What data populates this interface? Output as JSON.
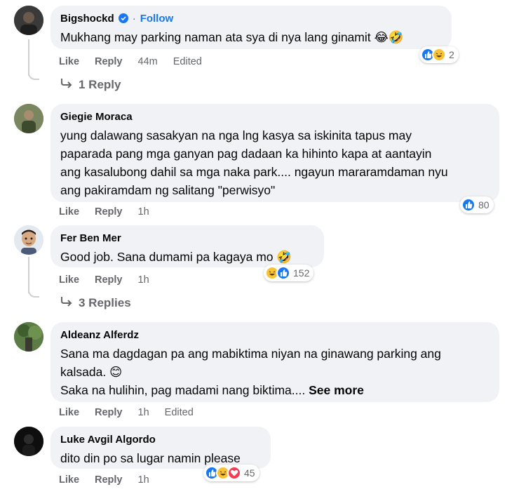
{
  "comments": [
    {
      "name": "Bigshockd",
      "verified": true,
      "follow": "Follow",
      "dot": "·",
      "text": "Mukhang may parking naman ata sya di nya lang ginamit 😂🤣",
      "like": "Like",
      "reply": "Reply",
      "time": "44m",
      "edited": "Edited",
      "reactions": [
        "like",
        "haha"
      ],
      "reaction_count": "2",
      "replies_label": "1 Reply"
    },
    {
      "name": "Giegie Moraca",
      "text_lines": [
        "yung dalawang sasakyan na nga lng kasya sa iskinita tapus may",
        "paparada pang mga ganyan pag dadaan ka hihinto kapa at aantayin",
        "ang kasalubong dahil sa mga naka park.... ngayun mararamdaman nyu",
        "ang pakiramdam ng salitang \"perwisyo\""
      ],
      "like": "Like",
      "reply": "Reply",
      "time": "1h",
      "reactions": [
        "like"
      ],
      "reaction_count": "80"
    },
    {
      "name": "Fer Ben Mer",
      "text": "Good job. Sana dumami pa kagaya mo 🤣",
      "like": "Like",
      "reply": "Reply",
      "time": "1h",
      "reactions": [
        "haha",
        "like"
      ],
      "reaction_count": "152",
      "replies_label": "3 Replies"
    },
    {
      "name": "Aldeanz Alferdz",
      "text_line1": "Sana ma dagdagan pa ang mabiktima niyan na ginawang parking ang",
      "text_line2": "kalsada. 😊",
      "text_line3": "Saka na hulihin, pag madami nang biktima....",
      "see_more": "See more",
      "like": "Like",
      "reply": "Reply",
      "time": "1h",
      "edited": "Edited"
    },
    {
      "name": "Luke Avgil Algordo",
      "text": "dito din po sa lugar namin please",
      "like": "Like",
      "reply": "Reply",
      "time": "1h",
      "reactions": [
        "like",
        "haha",
        "love"
      ],
      "reaction_count": "45"
    }
  ],
  "colors": {
    "bubble": "#f0f2f5",
    "link_blue": "#1877f2",
    "meta_gray": "#65676b",
    "haha_yellow": "#f7c234",
    "love_red": "#f33e58"
  },
  "icons": {
    "verified": "verified-badge-icon",
    "reply_arrow": "reply-arrow-icon",
    "like_reaction": "thumbs-up-icon",
    "haha_reaction": "laughing-face-icon",
    "love_reaction": "heart-icon"
  }
}
